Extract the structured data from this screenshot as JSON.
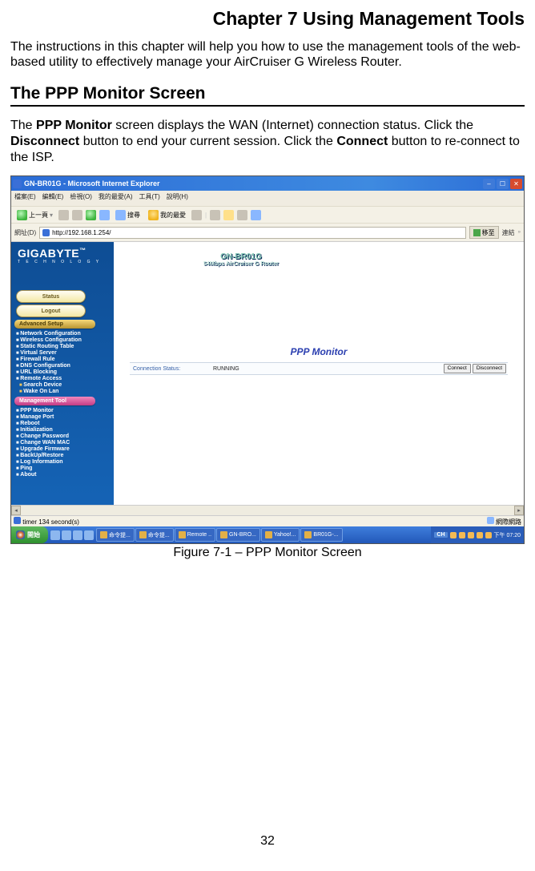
{
  "chapter_title": "Chapter 7 Using Management Tools",
  "intro": "The instructions in this chapter will help you how to use the management tools of the web-based utility to effectively manage your AirCruiser G Wireless Router.",
  "section_title": "The PPP Monitor Screen",
  "body": {
    "t1": "The ",
    "b1": "PPP Monitor",
    "t2": " screen displays the WAN (Internet) connection status. Click the ",
    "b2": "Disconnect",
    "t3": " button to end your current session. Click the ",
    "b3": "Connect",
    "t4": " button to re-connect to the ISP."
  },
  "figcap": "Figure 7-1 – PPP Monitor Screen",
  "pagenum": "32",
  "ie": {
    "title": "GN-BR01G - Microsoft Internet Explorer",
    "menubar": "檔案(E)　編輯(E)　檢視(O)　我的最愛(A)　工具(T)　說明(H)",
    "back": "上一頁",
    "search": "搜尋",
    "fav": "我的最愛",
    "addr_label": "網址(D)",
    "url": "http://192.168.1.254/",
    "go": "移至",
    "links": "連結",
    "timer": "timer 134 second(s)",
    "internet_zone": "網際網路"
  },
  "router": {
    "brand": "GIGABYTE",
    "brand_sub": "T E C H N O L O G Y",
    "model": "GN-BR01G",
    "model_sub": "54Mbps AirCruiser G Router",
    "status": "Status",
    "logout": "Logout",
    "adv_hdr": "Advanced Setup",
    "mgmt_hdr": "Management Tool",
    "adv_items": [
      "Network Configuration",
      "Wireless Configuration",
      "Static Routing Table",
      "Virtual Server",
      "Firewall Rule",
      "DNS Configuration",
      "URL Blocking",
      "Remote Access"
    ],
    "adv_sub": [
      "Search Device",
      "Wake On Lan"
    ],
    "mgmt_items": [
      "PPP Monitor",
      "Manage Port",
      "Reboot",
      "Initialization",
      "Change Password",
      "Change WAN MAC",
      "Upgrade Firmware",
      "BackUp/Restore",
      "Log Information",
      "Ping",
      "About"
    ],
    "ppp_title": "PPP Monitor",
    "conn_label": "Connection Status:",
    "conn_val": "RUNNING",
    "btn_connect": "Connect",
    "btn_disconnect": "Disconnect"
  },
  "taskbar": {
    "start": "開始",
    "tasks": [
      "命令提...",
      "命令提...",
      "Remote ..",
      "GN-BRO...",
      "Yahoo!...",
      "BR01G-..."
    ],
    "lang": "CH",
    "clock": "下午 07:20"
  }
}
